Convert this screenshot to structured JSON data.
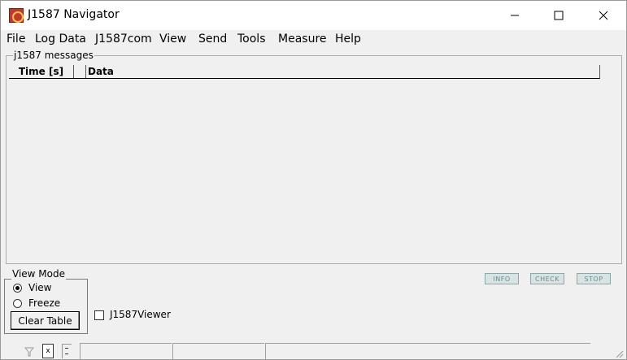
{
  "window": {
    "title": "J1587 Navigator",
    "controls": [
      "minimize",
      "maximize",
      "close"
    ]
  },
  "menu": {
    "items": [
      "File",
      "Log Data",
      "J1587com",
      "View",
      "Send",
      "Tools",
      "Measure",
      "Help"
    ]
  },
  "messages": {
    "group_label": "j1587 messages",
    "columns": [
      "Time [s]",
      "",
      "Data"
    ],
    "rows": []
  },
  "view_mode": {
    "group_label": "View Mode",
    "options": [
      {
        "label": "View",
        "selected": true
      },
      {
        "label": "Freeze",
        "selected": false
      }
    ],
    "clear_button": "Clear Table"
  },
  "viewer": {
    "label": "J1587Viewer",
    "checked": false
  },
  "status_buttons": [
    "INFO",
    "CHECK",
    "STOP"
  ],
  "statusbar": {
    "icons": [
      "filter-icon",
      "x-icon",
      "dots-icon"
    ],
    "panels": [
      "",
      "",
      ""
    ]
  },
  "colors": {
    "status_button_bg": "#d8e4e4",
    "status_button_text": "#6b8b8b",
    "app_icon": "#c0392b"
  }
}
